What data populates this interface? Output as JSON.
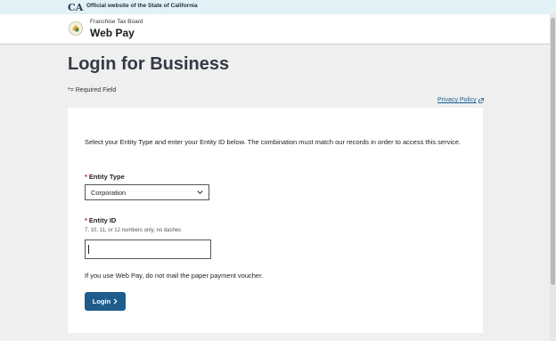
{
  "banner": {
    "logo_text": "CA",
    "text": "Official website of the State of California"
  },
  "header": {
    "agency": "Franchise Tax Board",
    "app_name": "Web Pay"
  },
  "page": {
    "title": "Login for Business",
    "required_note": "*= Required Field",
    "privacy_link": "Privacy Policy"
  },
  "form": {
    "intro": "Select your Entity Type and enter your Entity ID below. The combination must match our records in order to access this service.",
    "required_marker": "*",
    "entity_type_label": "Entity Type",
    "entity_type_value": "Corporation",
    "entity_id_label": "Entity ID",
    "entity_id_hint": "7, 10, 11, or 12 numbers only, no dashes",
    "entity_id_value": "",
    "notice": "If you use Web Pay, do not mail the paper payment voucher.",
    "login_label": "Login"
  },
  "icons": {
    "state_logo": "ca-state-logo-icon",
    "ftb_seal": "ftb-seal-icon",
    "external_link": "external-link-icon",
    "select_chevron": "chevron-down-icon",
    "button_chevron": "chevron-right-icon"
  },
  "colors": {
    "banner_bg": "#e2f1f6",
    "page_bg": "#efefef",
    "link": "#1c5e8e",
    "button_bg": "#1d5c8b",
    "required": "#c8102e"
  }
}
